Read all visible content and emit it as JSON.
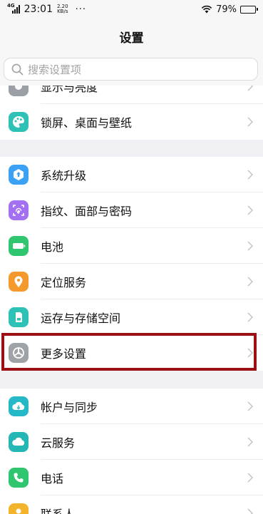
{
  "status_bar": {
    "network": "4G",
    "time": "23:01",
    "speed_value": "2.20",
    "speed_unit": "KB/s",
    "overflow": "···",
    "battery_percent": "79%",
    "battery_level": 0.79
  },
  "header": {
    "title": "设置"
  },
  "search": {
    "placeholder": "搜索设置项"
  },
  "groups": [
    {
      "items": [
        {
          "label": "显示与亮度",
          "icon": "display-brightness-icon",
          "color": "#9aa0a6"
        },
        {
          "label": "锁屏、桌面与壁纸",
          "icon": "palette-icon",
          "color": "#2ec2b7"
        }
      ]
    },
    {
      "items": [
        {
          "label": "系统升级",
          "icon": "system-update-icon",
          "color": "#3ba1f5"
        },
        {
          "label": "指纹、面部与密码",
          "icon": "fingerprint-icon",
          "color": "#a270f0"
        },
        {
          "label": "电池",
          "icon": "battery-icon",
          "color": "#2fc66f"
        },
        {
          "label": "定位服务",
          "icon": "location-icon",
          "color": "#f49a2c"
        },
        {
          "label": "运存与存储空间",
          "icon": "storage-icon",
          "color": "#2ec2b7"
        },
        {
          "label": "更多设置",
          "icon": "more-settings-icon",
          "color": "#9ea3a8"
        }
      ]
    },
    {
      "items": [
        {
          "label": "帐户与同步",
          "icon": "account-sync-icon",
          "color": "#25b8c7"
        },
        {
          "label": "云服务",
          "icon": "cloud-service-icon",
          "color": "#24b7b4"
        },
        {
          "label": "电话",
          "icon": "phone-icon",
          "color": "#2fc66f"
        },
        {
          "label": "联系人",
          "icon": "contacts-icon",
          "color": "#f3b32b"
        }
      ]
    }
  ]
}
